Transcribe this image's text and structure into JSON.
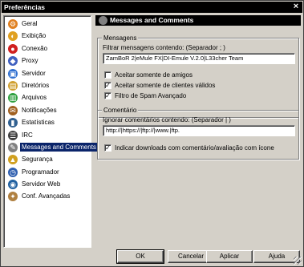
{
  "window": {
    "title": "Preferências",
    "close_glyph": "×"
  },
  "nav": {
    "items": [
      {
        "label": "Geral",
        "icon": "gear-icon",
        "color": "#e08020",
        "glyph": "⚙"
      },
      {
        "label": "Exibição",
        "icon": "display-icon",
        "color": "#e0a020",
        "glyph": "◐"
      },
      {
        "label": "Conexão",
        "icon": "connection-icon",
        "color": "#d02020",
        "glyph": "●"
      },
      {
        "label": "Proxy",
        "icon": "proxy-icon",
        "color": "#4060c0",
        "glyph": "◆"
      },
      {
        "label": "Servidor",
        "icon": "server-icon",
        "color": "#3070d0",
        "glyph": "▣"
      },
      {
        "label": "Diretórios",
        "icon": "folder-icon",
        "color": "#d0a030",
        "glyph": "▤"
      },
      {
        "label": "Arquivos",
        "icon": "files-icon",
        "color": "#30a040",
        "glyph": "▥"
      },
      {
        "label": "Notificações",
        "icon": "notification-icon",
        "color": "#a06020",
        "glyph": "✉"
      },
      {
        "label": "Estatísticas",
        "icon": "statistics-icon",
        "color": "#306090",
        "glyph": "▮"
      },
      {
        "label": "IRC",
        "icon": "irc-icon",
        "color": "#404040",
        "glyph": "☰"
      },
      {
        "label": "Messages and Comments",
        "icon": "messages-icon",
        "color": "#808080",
        "glyph": "✎",
        "selected": true
      },
      {
        "label": "Segurança",
        "icon": "security-icon",
        "color": "#d0a020",
        "glyph": "▲"
      },
      {
        "label": "Programador",
        "icon": "scheduler-icon",
        "color": "#3060b0",
        "glyph": "◷"
      },
      {
        "label": "Servidor Web",
        "icon": "web-server-icon",
        "color": "#2060a0",
        "glyph": "◉"
      },
      {
        "label": "Conf. Avançadas",
        "icon": "advanced-settings-icon",
        "color": "#b08040",
        "glyph": "✦"
      }
    ]
  },
  "panel": {
    "title": "Messages and Comments",
    "messages_group": {
      "title": "Mensagens",
      "filter_label": "Filtrar mensagens contendo: (Separador ; )",
      "filter_value": "ZamBoR 2|eMule FX|DI-Emule V.2.0|L33cher Team",
      "checkboxes": [
        {
          "label": "Aceitar somente de amigos",
          "checked": false
        },
        {
          "label": "Aceitar somente de clientes válidos",
          "checked": true
        },
        {
          "label": "Filtro de Spam Avançado",
          "checked": true
        }
      ]
    },
    "comments_group": {
      "title": "Comentário",
      "ignore_label": "Ignorar comentários contendo: (Separador | )",
      "ignore_value": "http://|https://|ftp://|www.|ftp.",
      "show_comments_label": "Indicar downloads com comentário/avaliação com ícone",
      "show_comments_checked": true
    }
  },
  "buttons": {
    "ok": "OK",
    "cancel": "Cancelar",
    "apply": "Aplicar",
    "help": "Ajuda"
  },
  "check_glyph": "✓"
}
